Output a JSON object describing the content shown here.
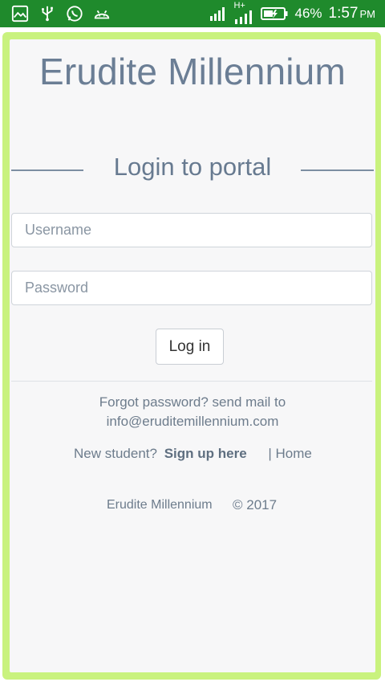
{
  "statusbar": {
    "battery": "46%",
    "time": "1:57",
    "ampm": "PM",
    "network_label": "H+",
    "bg_color": "#1f8a2c",
    "icons": [
      "gallery-icon",
      "usb-icon",
      "whatsapp-icon",
      "android-icon",
      "signal-icon",
      "signal-hplus-icon",
      "battery-charging-icon"
    ]
  },
  "header": {
    "brand": "Erudite Millennium"
  },
  "login": {
    "title": "Login to portal",
    "username_placeholder": "Username",
    "password_placeholder": "Password",
    "login_button": "Log in"
  },
  "help": {
    "forgot_line1": "Forgot password? send mail to",
    "forgot_line2": "info@eruditemillennium.com",
    "new_student": "New student?",
    "signup_link": "Sign up here",
    "home_link": "| Home"
  },
  "footer": {
    "name": "Erudite Millennium",
    "copyright": "© 2017"
  },
  "colors": {
    "frame": "#c9f27e",
    "page_bg": "#f7f7f8",
    "text": "#6b7e95"
  }
}
